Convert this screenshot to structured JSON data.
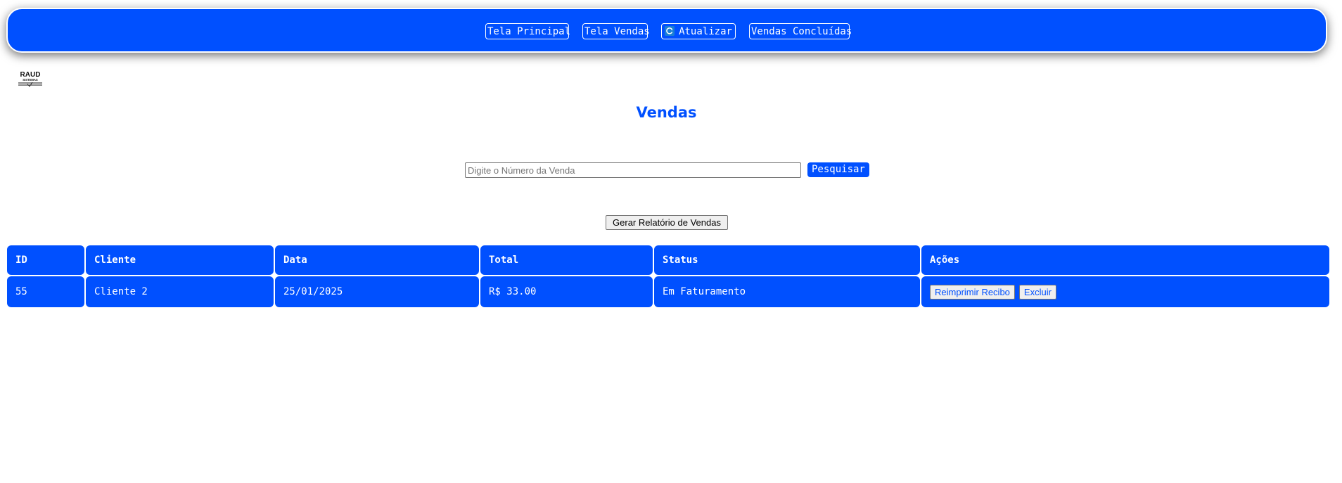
{
  "nav": {
    "home_label": "Tela Principal",
    "sales_label": "Tela Vendas",
    "refresh_label": "Atualizar",
    "completed_label": "Vendas Concluídas"
  },
  "logo": {
    "text": "RAUD",
    "subtext": "SISTEMAS"
  },
  "page": {
    "title": "Vendas"
  },
  "search": {
    "placeholder": "Digite o Número da Venda",
    "value": "",
    "button_label": "Pesquisar"
  },
  "report": {
    "button_label": "Gerar Relatório de Vendas"
  },
  "table": {
    "headers": [
      "ID",
      "Cliente",
      "Data",
      "Total",
      "Status",
      "Ações"
    ],
    "rows": [
      {
        "id": "55",
        "client": "Cliente 2",
        "date": "25/01/2025",
        "total": "R$ 33.00",
        "status": "Em Faturamento",
        "reprint_label": "Reimprimir Recibo",
        "delete_label": "Excluir"
      }
    ]
  },
  "colors": {
    "primary": "#0050ff",
    "text_on_primary": "#ffffff",
    "background": "#ffffff"
  },
  "icons": {
    "refresh": "refresh-icon"
  }
}
